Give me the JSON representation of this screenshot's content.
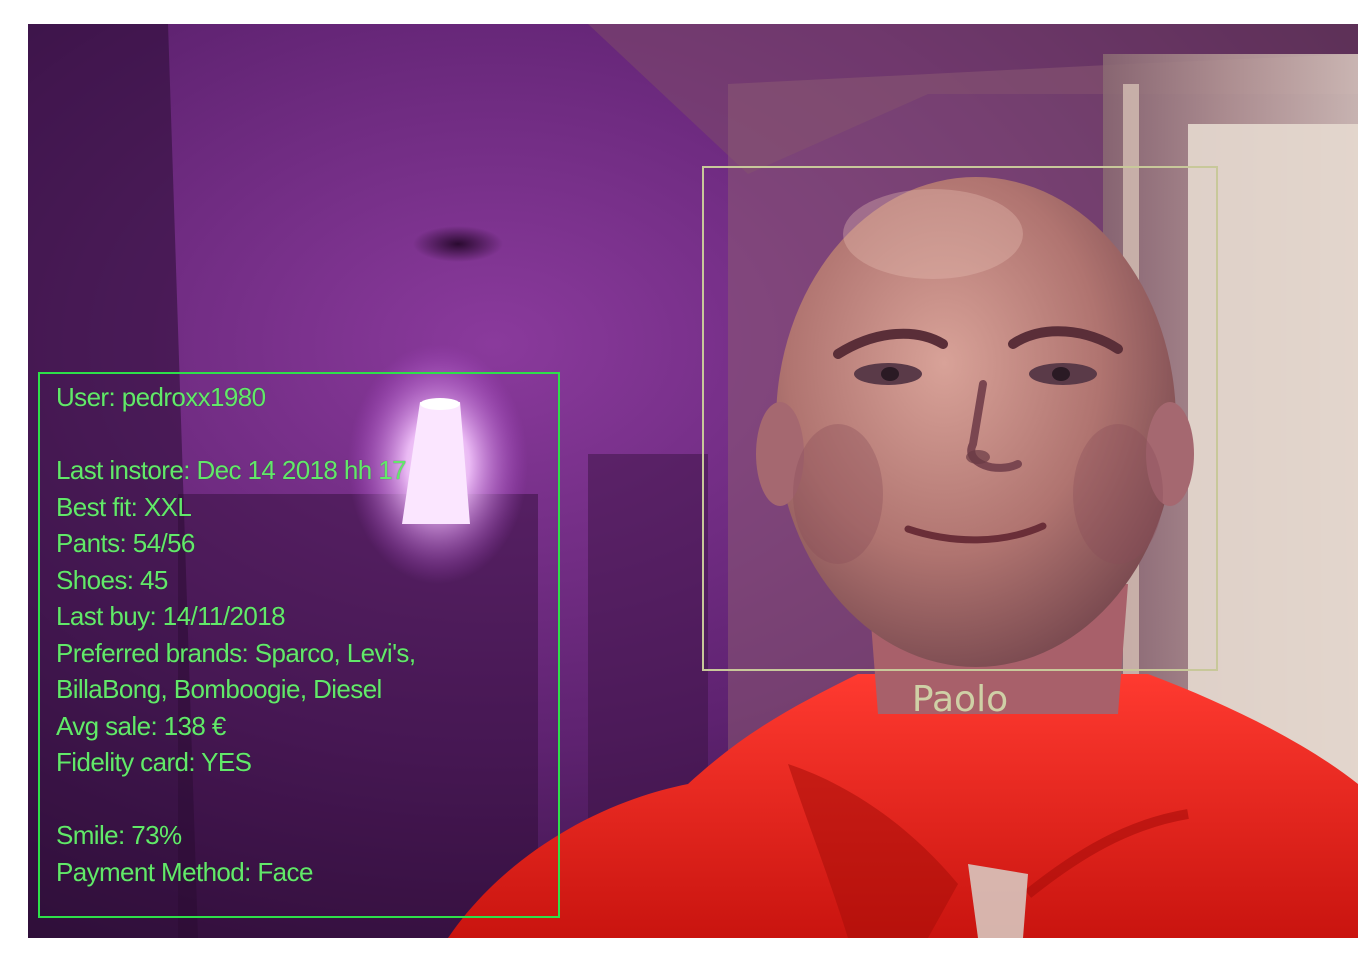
{
  "overlay": {
    "user_info": {
      "user": "User: pedroxx1980",
      "last_instore": "Last instore: Dec 14 2018 hh 17",
      "best_fit": "Best fit: XXL",
      "pants": "Pants: 54/56",
      "shoes": "Shoes: 45",
      "last_buy": "Last buy: 14/11/2018",
      "preferred_brands_line1": "Preferred brands: Sparco, Levi's,",
      "preferred_brands_line2": "BillaBong, Bomboogie, Diesel",
      "avg_sale": "Avg sale: 138 €",
      "fidelity_card": "Fidelity card: YES",
      "smile": "Smile: 73%",
      "payment_method": "Payment Method: Face"
    },
    "face_detection": {
      "name": "Paolo"
    }
  },
  "colors": {
    "info_box_border": "#2ee04a",
    "info_text": "#62e86a",
    "face_box_border": "#c8c89a",
    "face_label": "#cfd0a6",
    "room_wall": "#6a2a7a",
    "hoodie": "#e0231e"
  }
}
